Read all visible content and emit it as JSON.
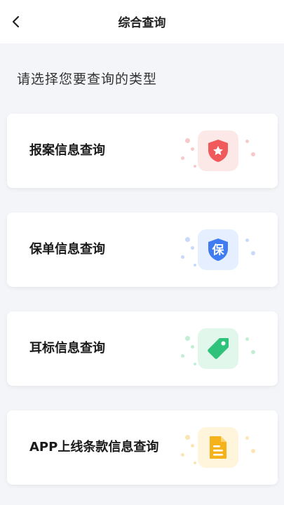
{
  "header": {
    "title": "综合查询",
    "back_icon": "chevron-left-icon"
  },
  "prompt": "请选择您要查询的类型",
  "cards": [
    {
      "label": "报案信息查询",
      "icon": "shield-star-icon",
      "accent": "#f15a5a",
      "tile_bg": "#fde8e8",
      "dot_color": "#f8c9c9"
    },
    {
      "label": "保单信息查询",
      "icon": "shield-bao-icon",
      "accent": "#3f7cf2",
      "tile_bg": "#e6efff",
      "dot_color": "#c8d9fb",
      "icon_text": "保"
    },
    {
      "label": "耳标信息查询",
      "icon": "tag-icon",
      "accent": "#2fc27a",
      "tile_bg": "#e2f7ec",
      "dot_color": "#c2eed6"
    },
    {
      "label": "APP上线条款信息查询",
      "icon": "document-icon",
      "accent": "#f6b21a",
      "tile_bg": "#fff4dc",
      "dot_color": "#fbe5b4"
    }
  ]
}
